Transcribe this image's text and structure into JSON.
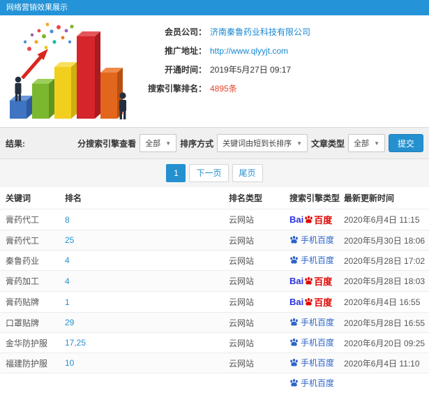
{
  "header": {
    "title": "网络营销效果展示"
  },
  "profile": {
    "labels": {
      "company": "会员公司：",
      "url": "推广地址：",
      "open_time": "开通时间：",
      "rank_count": "搜索引擎排名："
    },
    "company": "济南秦鲁药业科技有限公司",
    "url": "http://www.qlyyjt.com",
    "open_time": "2019年5月27日 09:17",
    "rank_count": "4895条"
  },
  "filters": {
    "result_label": "结果:",
    "engine_label": "分搜索引擎查看",
    "engine_value": "全部",
    "sort_label": "排序方式",
    "sort_value": "关键词由短到长排序",
    "type_label": "文章类型",
    "type_value": "全部",
    "submit_label": "提交"
  },
  "pagination": {
    "current": "1",
    "next": "下一页",
    "last": "尾页"
  },
  "icons": {
    "dropdown_caret": "▼",
    "baidu_paw": "baidu-paw-icon"
  },
  "logos": {
    "baidu_pc_latin": "Bai",
    "baidu_pc_cn": "百度",
    "baidu_mobile": "手机百度"
  },
  "colors": {
    "accent": "#2590d0",
    "baidu_blue": "#2932e1",
    "baidu_red": "#e10602",
    "mobile_blue": "#2d64c8",
    "count_red": "#e5432a"
  },
  "table": {
    "headers": [
      "关键词",
      "排名",
      "排名类型",
      "搜索引擎类型",
      "最新更新时间"
    ],
    "rows": [
      {
        "keyword": "膏药代工",
        "rank": "8",
        "rank_type": "云网站",
        "engine": "baidu",
        "updated": "2020年6月4日 11:15"
      },
      {
        "keyword": "膏药代工",
        "rank": "25",
        "rank_type": "云网站",
        "engine": "mobile",
        "updated": "2020年5月30日 18:06"
      },
      {
        "keyword": "秦鲁药业",
        "rank": "4",
        "rank_type": "云网站",
        "engine": "mobile",
        "updated": "2020年5月28日 17:02"
      },
      {
        "keyword": "膏药加工",
        "rank": "4",
        "rank_type": "云网站",
        "engine": "baidu",
        "updated": "2020年5月28日 18:03"
      },
      {
        "keyword": "膏药贴牌",
        "rank": "1",
        "rank_type": "云网站",
        "engine": "baidu",
        "updated": "2020年6月4日 16:55"
      },
      {
        "keyword": "口罩贴牌",
        "rank": "29",
        "rank_type": "云网站",
        "engine": "mobile",
        "updated": "2020年5月28日 16:55"
      },
      {
        "keyword": "金华防护服",
        "rank": "17,25",
        "rank_type": "云网站",
        "engine": "mobile",
        "updated": "2020年6月20日 09:25"
      },
      {
        "keyword": "福建防护服",
        "rank": "10",
        "rank_type": "云网站",
        "engine": "mobile",
        "updated": "2020年6月4日 11:10"
      }
    ],
    "partial_row_engine": "mobile"
  }
}
